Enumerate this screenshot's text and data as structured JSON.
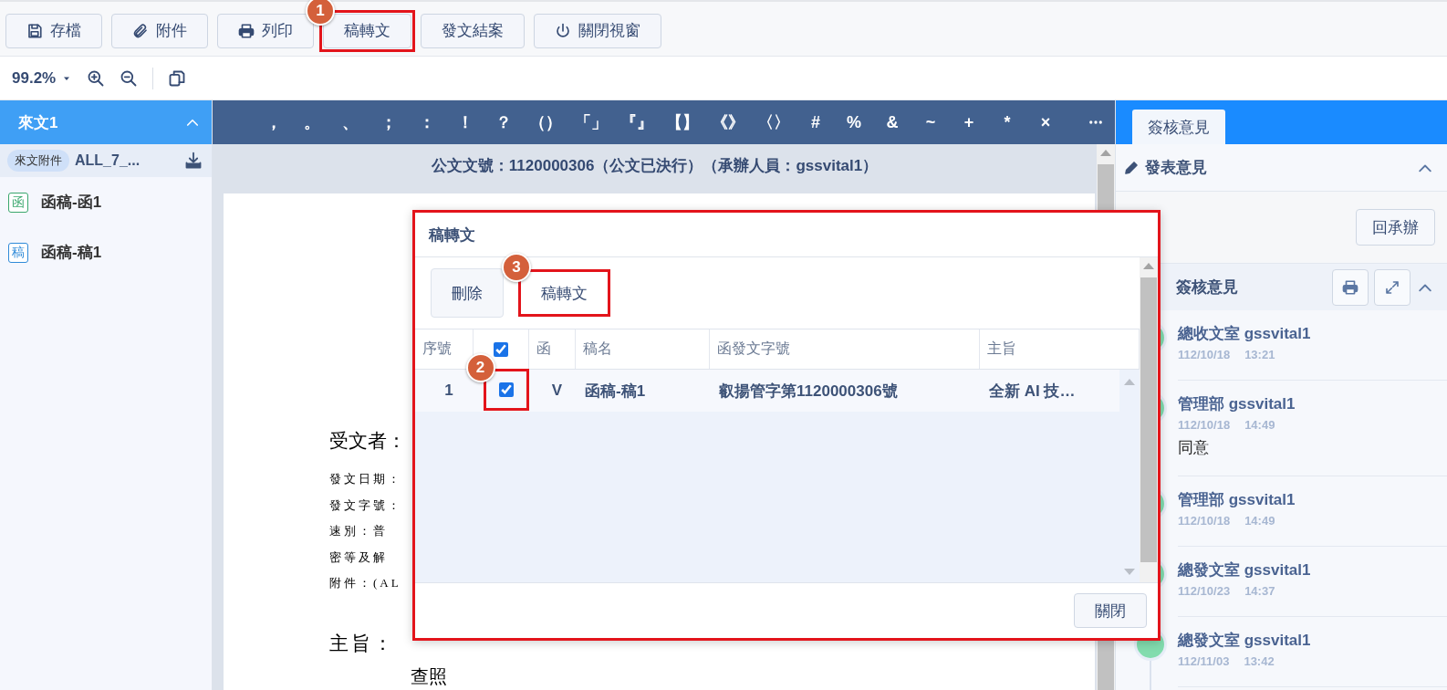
{
  "toolbar": {
    "buttons": [
      {
        "label": "存檔",
        "highlighted": false
      },
      {
        "label": "附件",
        "highlighted": false
      },
      {
        "label": "列印",
        "highlighted": false
      },
      {
        "label": "稿轉文",
        "highlighted": true,
        "callout": "1"
      },
      {
        "label": "發文結案",
        "highlighted": false
      },
      {
        "label": "關閉視窗",
        "highlighted": false
      }
    ]
  },
  "zoom_bar": {
    "zoom": "99.2%"
  },
  "sidebar": {
    "header": "來文1",
    "expanded": true,
    "attachment": {
      "tag": "來文附件",
      "name": "ALL_7_..."
    },
    "items": [
      {
        "badge": "函",
        "label": "函稿-函1",
        "color": "#3aa76d"
      },
      {
        "badge": "稿",
        "label": "函稿-稿1",
        "color": "#2f8ad8"
      }
    ]
  },
  "punctuation_bar": {
    "symbols": [
      "，",
      "。",
      "、",
      "；",
      "：",
      "！",
      "？",
      "（）",
      "「」",
      "『』",
      "【】",
      "《》",
      "〈〉",
      "#",
      "%",
      "&",
      "~",
      "+",
      "*",
      "×"
    ]
  },
  "document": {
    "header": "公文文號：1120000306（公文已決行）（承辦人員：gssvital1）",
    "recipient": "受文者：",
    "fields": [
      "發文日期：",
      "發文字號：",
      "速別：普",
      "密等及解",
      "附件：(AL"
    ],
    "subject_label": "主旨：",
    "subject_tail": "查照"
  },
  "review_panel": {
    "tabs": [
      {
        "label": "簽核意見",
        "selected": true
      }
    ],
    "comment_section": {
      "title": "發表意見",
      "expanded": true,
      "button": "回承辦"
    },
    "history": {
      "title": "簽核意見",
      "expanded": true,
      "entries": [
        {
          "author": "總收文室 gssvital1",
          "date": "112/10/18",
          "time": "13:21"
        },
        {
          "author": "管理部 gssvital1",
          "date": "112/10/18",
          "time": "14:49",
          "comment": "同意"
        },
        {
          "author": "管理部 gssvital1",
          "date": "112/10/18",
          "time": "14:49"
        },
        {
          "author": "總發文室 gssvital1",
          "date": "112/10/23",
          "time": "14:37"
        },
        {
          "author": "總發文室 gssvital1",
          "date": "112/11/03",
          "time": "13:42"
        }
      ]
    }
  },
  "dialog": {
    "title": "稿轉文",
    "highlighted": true,
    "buttons": [
      {
        "label": "刪除",
        "highlighted": false
      },
      {
        "label": "稿轉文",
        "highlighted": true,
        "callout": "3"
      }
    ],
    "table": {
      "select_all": {
        "checked": true
      },
      "columns": [
        "序號",
        "函",
        "稿名",
        "函發文字號",
        "主旨"
      ],
      "rows": [
        {
          "cells": [
            "1",
            "V",
            "函稿-稿1",
            "叡揚管字第1120000306號",
            "全新 AI 技…"
          ],
          "checked": true,
          "highlighted": true,
          "callout": "2"
        }
      ]
    },
    "close_button": "關閉"
  }
}
